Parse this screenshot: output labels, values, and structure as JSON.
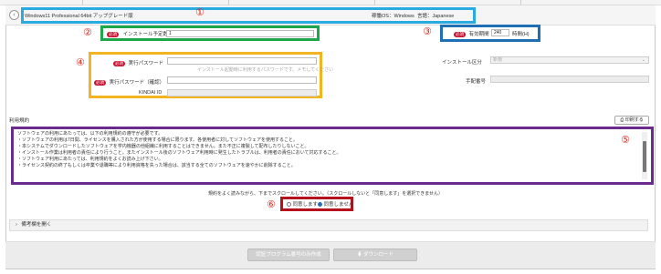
{
  "header": {
    "product": "Windows11 Professional 64bit アップグレード版",
    "os_label": "稼働OS：Windows",
    "lang_label": "言語：Japanese"
  },
  "markers": [
    "①",
    "②",
    "③",
    "④",
    "⑤",
    "⑥"
  ],
  "required_badge": "必須",
  "install_planned": {
    "label": "インストール予定数",
    "value": "1"
  },
  "validity": {
    "label": "有効期間",
    "value": "240",
    "unit": "時間(H)"
  },
  "password": {
    "label": "実行パスワード",
    "placeholder": "インストール起動時に利用するパスワードです。メモしてください",
    "confirm_label": "実行パスワード（確認）",
    "kindai_id_label": "KINDAI ID"
  },
  "install_target": {
    "label": "インストール区分",
    "value": "新規"
  },
  "procedure_no": {
    "label": "手配番号"
  },
  "terms": {
    "title": "利用規約",
    "print_button": "印刷する",
    "lines": [
      "ソフトウェアの利用にあたっては、以下の利用規約の遵守が必要です。",
      "・ソフトウェアの利用は7日間、ライセンスを購入された方が使用する場合に限ります。各使用者に対してソフトウェアを使用すること。",
      "・本システムでダウンロードしたソフトウェアを学内機器の他組織に利用することはできません。また不正に複製して配布したりしないこと。",
      "・インストール作業は利用者の責任により行うこと。またインストール後のソフトウェア利用時に発生したトラブルは、利用者の責任において対応すること。",
      "・ソフトウェア利用にあたっては、利用規約をよくお読み上げ下さい。",
      "・ライセンス契約の終了もしくは卒業や退職等により利用資格を失った場合は、該当する全てのソフトウェアを速やかに削除すること。"
    ]
  },
  "agree": {
    "instruction": "規約をよく読みながら、下までスクロールしてください。（スクロールしないと「同意します」を選択できません）",
    "options": [
      "同意します",
      "同意しません"
    ],
    "selected": "同意しません"
  },
  "notes_toggle": "備考欄を開く",
  "buttons": {
    "confirm": "認証プログラム番号のみ作成",
    "download": "ダウンロード"
  }
}
